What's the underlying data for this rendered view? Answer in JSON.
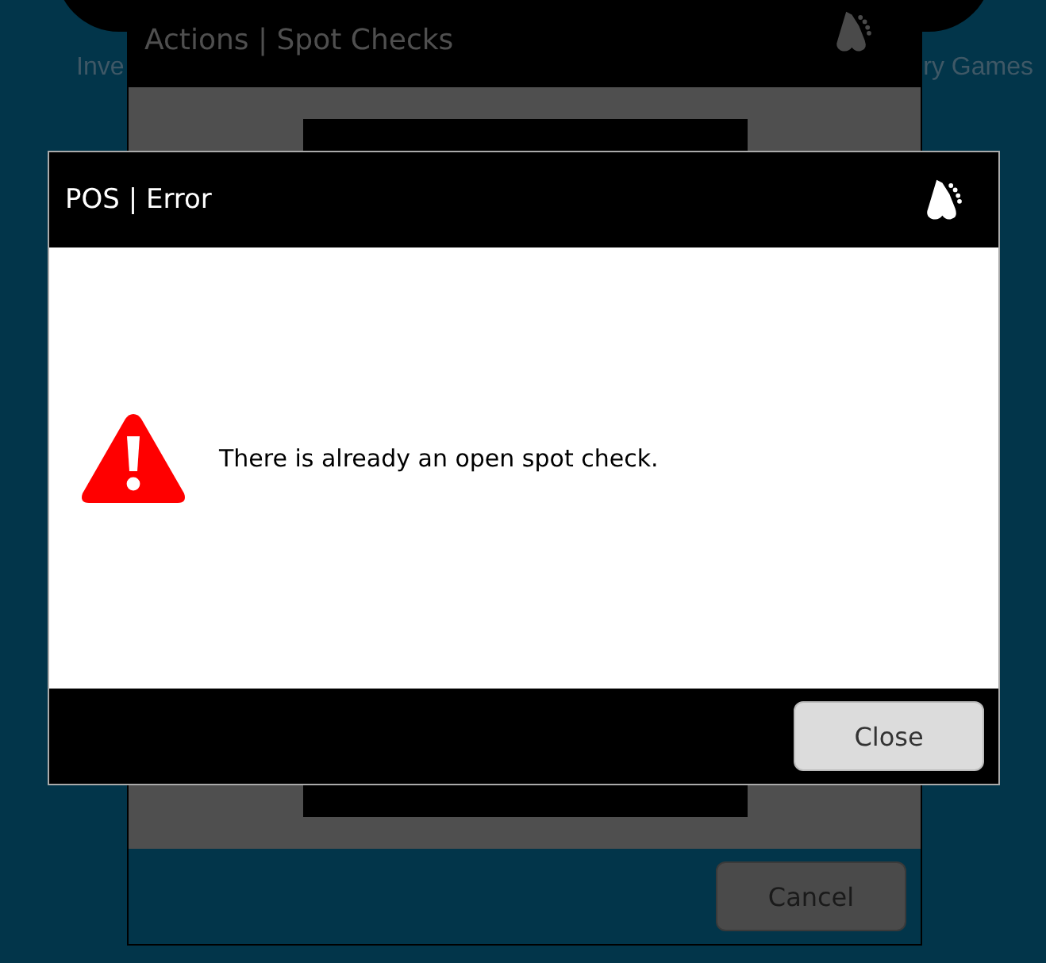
{
  "background": {
    "nav": [
      {
        "label": "Inve"
      },
      {
        "label": "ry Games"
      }
    ]
  },
  "back_window": {
    "title": "Actions | Spot Checks",
    "buttons": [
      {
        "label": "Cancel"
      }
    ]
  },
  "dialog": {
    "title": "POS | Error",
    "kind": "error",
    "message": "There is already an open spot check.",
    "buttons": [
      {
        "label": "Close"
      }
    ]
  }
}
